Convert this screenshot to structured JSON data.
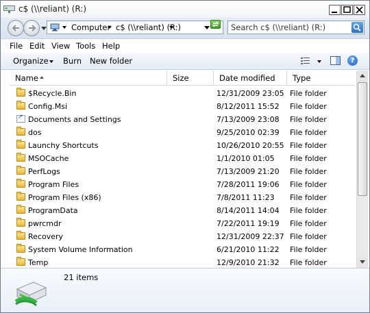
{
  "window": {
    "title": "c$ (\\\\reliant) (R:)",
    "icons": [
      "network-drive-icon",
      "minimize-icon",
      "maximize-icon",
      "close-icon"
    ]
  },
  "address_bar": {
    "segments": [
      "Computer",
      "c$ (\\\\reliant) (R:)"
    ],
    "search_placeholder": "Search c$ (\\\\reliant) (R:)"
  },
  "menu": [
    "File",
    "Edit",
    "View",
    "Tools",
    "Help"
  ],
  "commands": {
    "organize": "Organize",
    "burn": "Burn",
    "new_folder": "New folder"
  },
  "columns": {
    "name": "Name",
    "size": "Size",
    "date_modified": "Date modified",
    "type": "Type"
  },
  "files": [
    {
      "name": "$Recycle.Bin",
      "date": "12/31/2009 23:05",
      "type": "File folder",
      "icon": "folder-icon"
    },
    {
      "name": "Config.Msi",
      "date": "8/12/2011 15:52",
      "type": "File folder",
      "icon": "folder-icon"
    },
    {
      "name": "Documents and Settings",
      "date": "7/13/2009 23:08",
      "type": "File folder",
      "icon": "shortcut-folder-icon"
    },
    {
      "name": "dos",
      "date": "9/25/2010 02:39",
      "type": "File folder",
      "icon": "folder-icon"
    },
    {
      "name": "Launchy Shortcuts",
      "date": "10/26/2010 20:55",
      "type": "File folder",
      "icon": "folder-icon"
    },
    {
      "name": "MSOCache",
      "date": "1/1/2010 01:05",
      "type": "File folder",
      "icon": "folder-icon"
    },
    {
      "name": "PerfLogs",
      "date": "7/13/2009 21:20",
      "type": "File folder",
      "icon": "folder-icon"
    },
    {
      "name": "Program Files",
      "date": "7/28/2011 19:06",
      "type": "File folder",
      "icon": "folder-icon"
    },
    {
      "name": "Program Files (x86)",
      "date": "7/8/2011 11:23",
      "type": "File folder",
      "icon": "folder-icon"
    },
    {
      "name": "ProgramData",
      "date": "8/14/2011 14:04",
      "type": "File folder",
      "icon": "folder-icon"
    },
    {
      "name": "pwrcmdr",
      "date": "7/22/2011 19:19",
      "type": "File folder",
      "icon": "folder-icon"
    },
    {
      "name": "Recovery",
      "date": "12/31/2009 22:37",
      "type": "File folder",
      "icon": "folder-icon"
    },
    {
      "name": "System Volume Information",
      "date": "6/21/2010 11:22",
      "type": "File folder",
      "icon": "folder-icon"
    },
    {
      "name": "Temp",
      "date": "12/9/2010 21:32",
      "type": "File folder",
      "icon": "folder-icon"
    }
  ],
  "details": {
    "item_count": "21 items"
  }
}
